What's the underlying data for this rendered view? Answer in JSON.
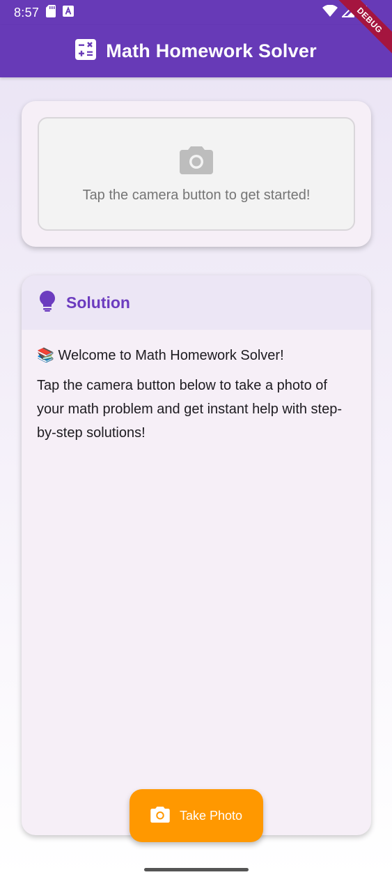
{
  "status_bar": {
    "time": "8:57",
    "left_icons": [
      "sd-card-icon",
      "text-a-icon"
    ],
    "right_icons": [
      "wifi-icon",
      "signal-icon",
      "battery-icon"
    ]
  },
  "app_bar": {
    "icon": "calculator-icon",
    "title": "Math Homework Solver",
    "background": "#673ab7"
  },
  "debug_banner": "DEBUG",
  "image_card": {
    "icon": "camera-icon",
    "hint": "Tap the camera button to get started!"
  },
  "solution_card": {
    "icon": "lightbulb-icon",
    "title": "Solution",
    "welcome": "📚 Welcome to Math Homework Solver!",
    "description": "Tap the camera button below to take a photo of your math problem and get instant help with step-by-step solutions!"
  },
  "fab": {
    "icon": "camera-icon",
    "label": "Take Photo",
    "color": "#ff9800"
  },
  "colors": {
    "primary": "#673ab7",
    "accent": "#ff9800",
    "solution_title": "#6c3cbf"
  }
}
